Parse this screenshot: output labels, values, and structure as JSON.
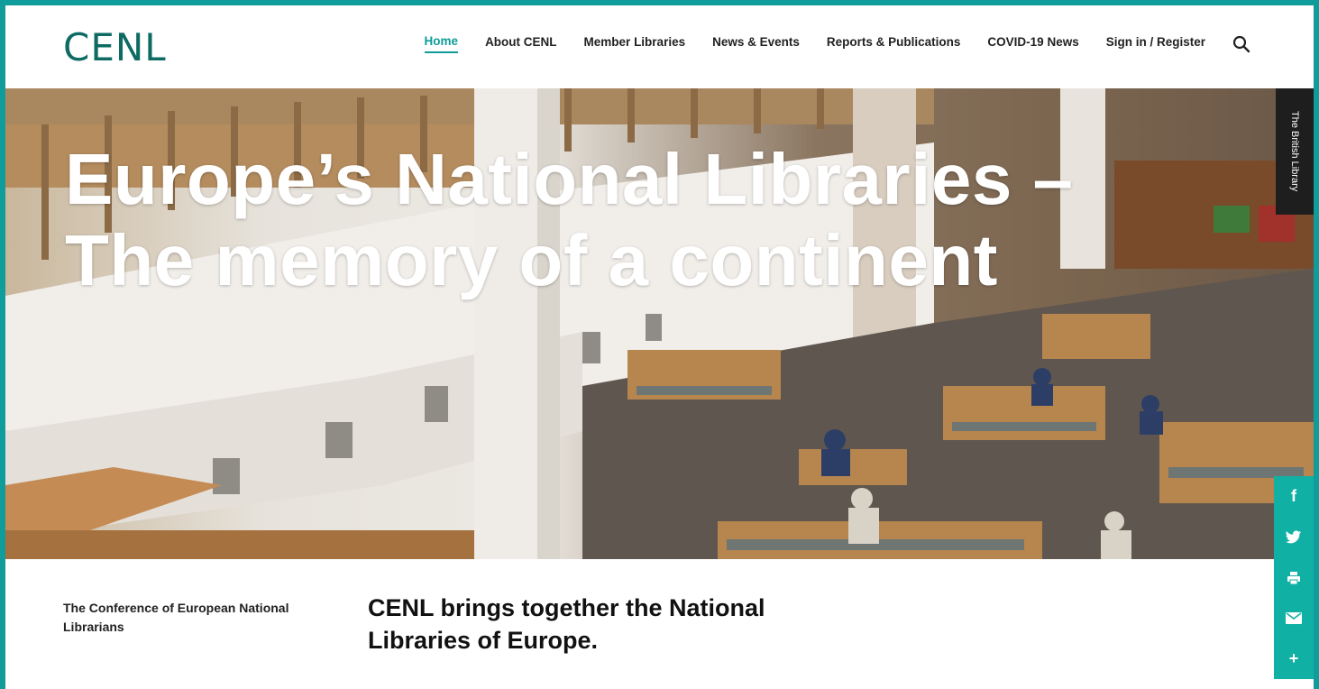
{
  "header": {
    "logo": "CENL",
    "nav": [
      {
        "label": "Home",
        "active": true
      },
      {
        "label": "About CENL"
      },
      {
        "label": "Member Libraries"
      },
      {
        "label": "News & Events"
      },
      {
        "label": "Reports & Publications"
      },
      {
        "label": "COVID-19 News"
      },
      {
        "label": "Sign in / Register"
      }
    ]
  },
  "hero": {
    "title_line1": "Europe’s National Libraries –",
    "title_line2": "The memory of a continent",
    "photo_credit": "The British Library"
  },
  "share": {
    "icons": [
      "facebook-icon",
      "twitter-icon",
      "print-icon",
      "email-icon",
      "plus-icon"
    ],
    "labels": [
      "f",
      "",
      "",
      "",
      "+"
    ]
  },
  "content": {
    "org_name": "The Conference of European National Librarians",
    "intro": "CENL brings together the National Libraries of Europe."
  },
  "colors": {
    "frame": "#0f9c9a",
    "logo": "#0d6b63",
    "accent": "#0f9c9a",
    "share_bar": "#11b0a5"
  }
}
